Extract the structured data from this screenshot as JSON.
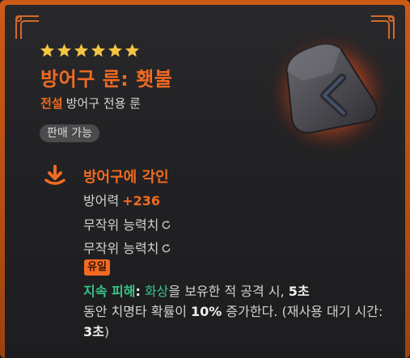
{
  "rating": {
    "stars": 6,
    "star_color": "#f4c542"
  },
  "item": {
    "name": "방어구 룬: 횃불",
    "grade": "전설",
    "type": "방어구 전용 룬",
    "tradable": "판매 가능",
    "icon": "torch-rune-icon"
  },
  "engrave": {
    "icon": "download-arrow-icon",
    "title": "방어구에 각인",
    "stat_label": "방어력",
    "stat_value": "+236",
    "random_stat_1": "무작위 능력치",
    "random_stat_2": "무작위 능력치",
    "random_icon": "refresh-icon"
  },
  "unique": {
    "badge": "유일",
    "effect_name": "지속 피해",
    "colon": ":",
    "status_name": "화상",
    "text_1": "을 보유한 적 공격 시,",
    "duration": "5초",
    "text_2": "동안 치명타 확률이",
    "crit_bonus": "10%",
    "text_3": "증가한다.",
    "cooldown_open": "(재사용 대기 시간:",
    "cooldown_value": "3초",
    "cooldown_close": ")"
  },
  "colors": {
    "accent": "#f26a21",
    "effect_green": "#38c488",
    "frame": "#cc5a17",
    "panel": "#232325"
  }
}
